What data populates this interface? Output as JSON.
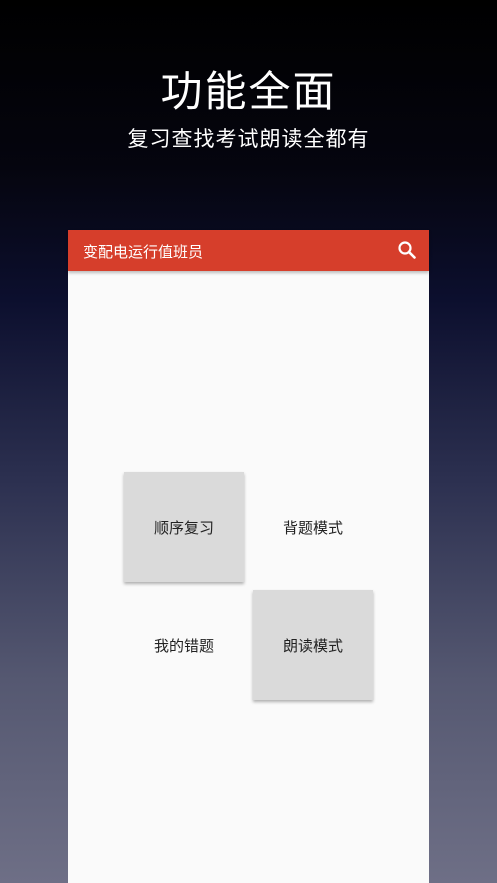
{
  "promo": {
    "title": "功能全面",
    "subtitle": "复习查找考试朗读全都有"
  },
  "app": {
    "title": "变配电运行值班员",
    "accent_color": "#d63e2b",
    "search_icon": "search-icon"
  },
  "menu": {
    "items": [
      {
        "label": "顺序复习",
        "style": "raised"
      },
      {
        "label": "背题模式",
        "style": "flat"
      },
      {
        "label": "我的错题",
        "style": "flat"
      },
      {
        "label": "朗读模式",
        "style": "raised"
      }
    ]
  }
}
